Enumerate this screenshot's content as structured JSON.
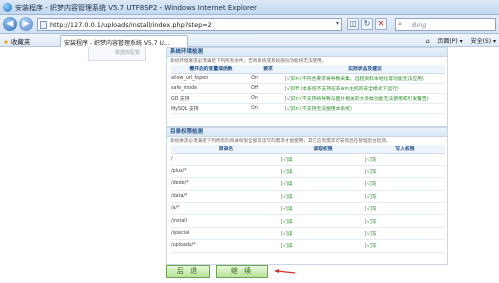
{
  "window": {
    "title": "安装程序 - 织梦内容管理系统 V5.7 UTF8SP2 - Windows Internet Explorer"
  },
  "addressbar": {
    "url": "http://127.0.0.1/uploads/install/index.php?step=2",
    "search_placeholder": "Bing"
  },
  "favorites": {
    "label": "收藏夹",
    "tab_title": "安装程序 - 织梦内容管理系统 V5.7 U...",
    "cmd_page": "页面(P) ▾",
    "cmd_safety": "安全(S) ▾"
  },
  "left_panel": {
    "label": "数据库配置"
  },
  "env_section": {
    "title": "系统环境检测",
    "description": "系统环境要求必须满足下列所有条件，否则系统或系统部份功能将无法使用。",
    "headers": [
      "需开启的变量或函数",
      "要求",
      "实际状态及建议"
    ],
    "rows": [
      {
        "name": "allow_url_fopen",
        "req": "On",
        "status": "[√]On (不符合要求将导致采集、远程资料本地化等功能无法应用)"
      },
      {
        "name": "safe_mode",
        "req": "Off",
        "status": "[√]Off (本系统不支持在非win主机的安全模式下运行)"
      },
      {
        "name": "GD 支持",
        "req": "On",
        "status": "[√]On (不支持将导致与图片相关的大多数功能无法使用或引发警告)"
      },
      {
        "name": "MySQL 支持",
        "req": "On",
        "status": "[√]On (不支持无法使用本系统)"
      }
    ]
  },
  "perm_section": {
    "title": "目录权限检测",
    "description": "系统要求必须满足下列所有的目录权限全部可读写的需求才能使用，其它应有需求可安装后在管理后台检测。",
    "headers": [
      "目录名",
      "读取权限",
      "写入权限"
    ],
    "rows": [
      {
        "dir": "/",
        "read": "[√]读",
        "write": "[√]写"
      },
      {
        "dir": "/plus/*",
        "read": "[√]读",
        "write": "[√]写"
      },
      {
        "dir": "/dede/*",
        "read": "[√]读",
        "write": "[√]写"
      },
      {
        "dir": "/data/*",
        "read": "[√]读",
        "write": "[√]写"
      },
      {
        "dir": "/a/*",
        "read": "[√]读",
        "write": "[√]写"
      },
      {
        "dir": "/install",
        "read": "[√]读",
        "write": "[√]写"
      },
      {
        "dir": "/special",
        "read": "[√]读",
        "write": "[√]写"
      },
      {
        "dir": "/uploads/*",
        "read": "[√]读",
        "write": "[√]写"
      }
    ]
  },
  "buttons": {
    "back": "后 退",
    "next": "继 续"
  },
  "colors": {
    "accent": "#1f4e86",
    "ok": "#2e8b2e",
    "button_green": "#b9e29a",
    "arrow": "#d32f2f"
  }
}
